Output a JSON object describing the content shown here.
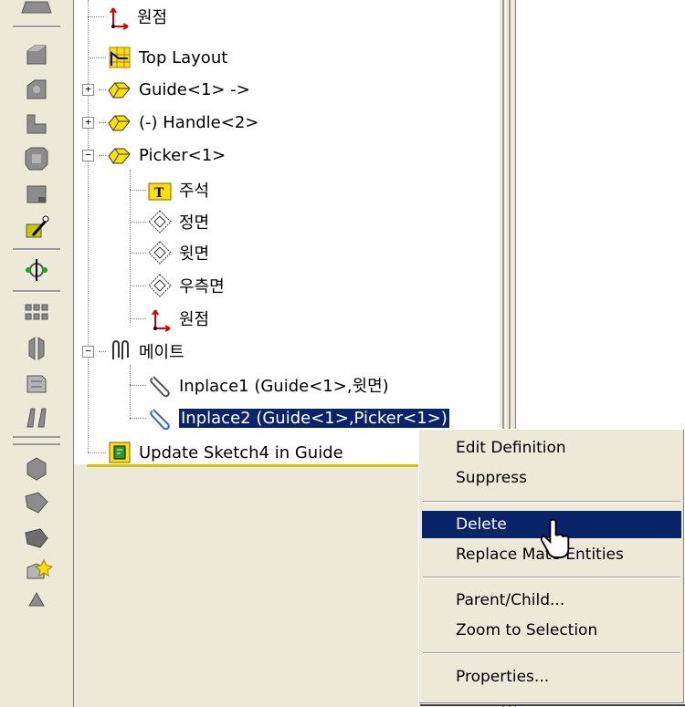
{
  "toolbar": {
    "buttons": [
      "assembly-icon",
      "extrude-icon",
      "revolve-icon",
      "sweep-icon",
      "loft-icon",
      "shell-icon",
      "smart-mate-icon",
      "move-component-icon",
      "pattern-icon",
      "mirror-icon",
      "explode-icon",
      "hole-series-icon",
      "interference-icon",
      "weld-icon",
      "smart-fasteners-icon",
      "toolbox-icon",
      "features-icon"
    ]
  },
  "tree": {
    "origin_top": "원점",
    "top_layout": "Top Layout",
    "guide": "Guide<1> ->",
    "handle": "(-) Handle<2>",
    "picker": "Picker<1>",
    "annotations": "주석",
    "front_plane": "정면",
    "top_plane": "윗면",
    "right_plane": "우측면",
    "origin_picker": "원점",
    "mates": "메이트",
    "inplace1": "Inplace1 (Guide<1>,윗면)",
    "inplace2": "Inplace2 (Guide<1>,Picker<1>)",
    "update_sketch": "Update Sketch4 in Guide",
    "expander_plus": "+",
    "expander_minus": "−"
  },
  "context_menu": {
    "edit_definition": "Edit Definition",
    "suppress": "Suppress",
    "delete": "Delete",
    "replace_mate_entities": "Replace Mate Entities",
    "parent_child": "Parent/Child...",
    "zoom_to_selection": "Zoom to Selection",
    "properties": "Properties..."
  },
  "colors": {
    "selection": "#0a246a",
    "menu_bg": "#ece9d8",
    "tree_bg": "#ffffff"
  }
}
